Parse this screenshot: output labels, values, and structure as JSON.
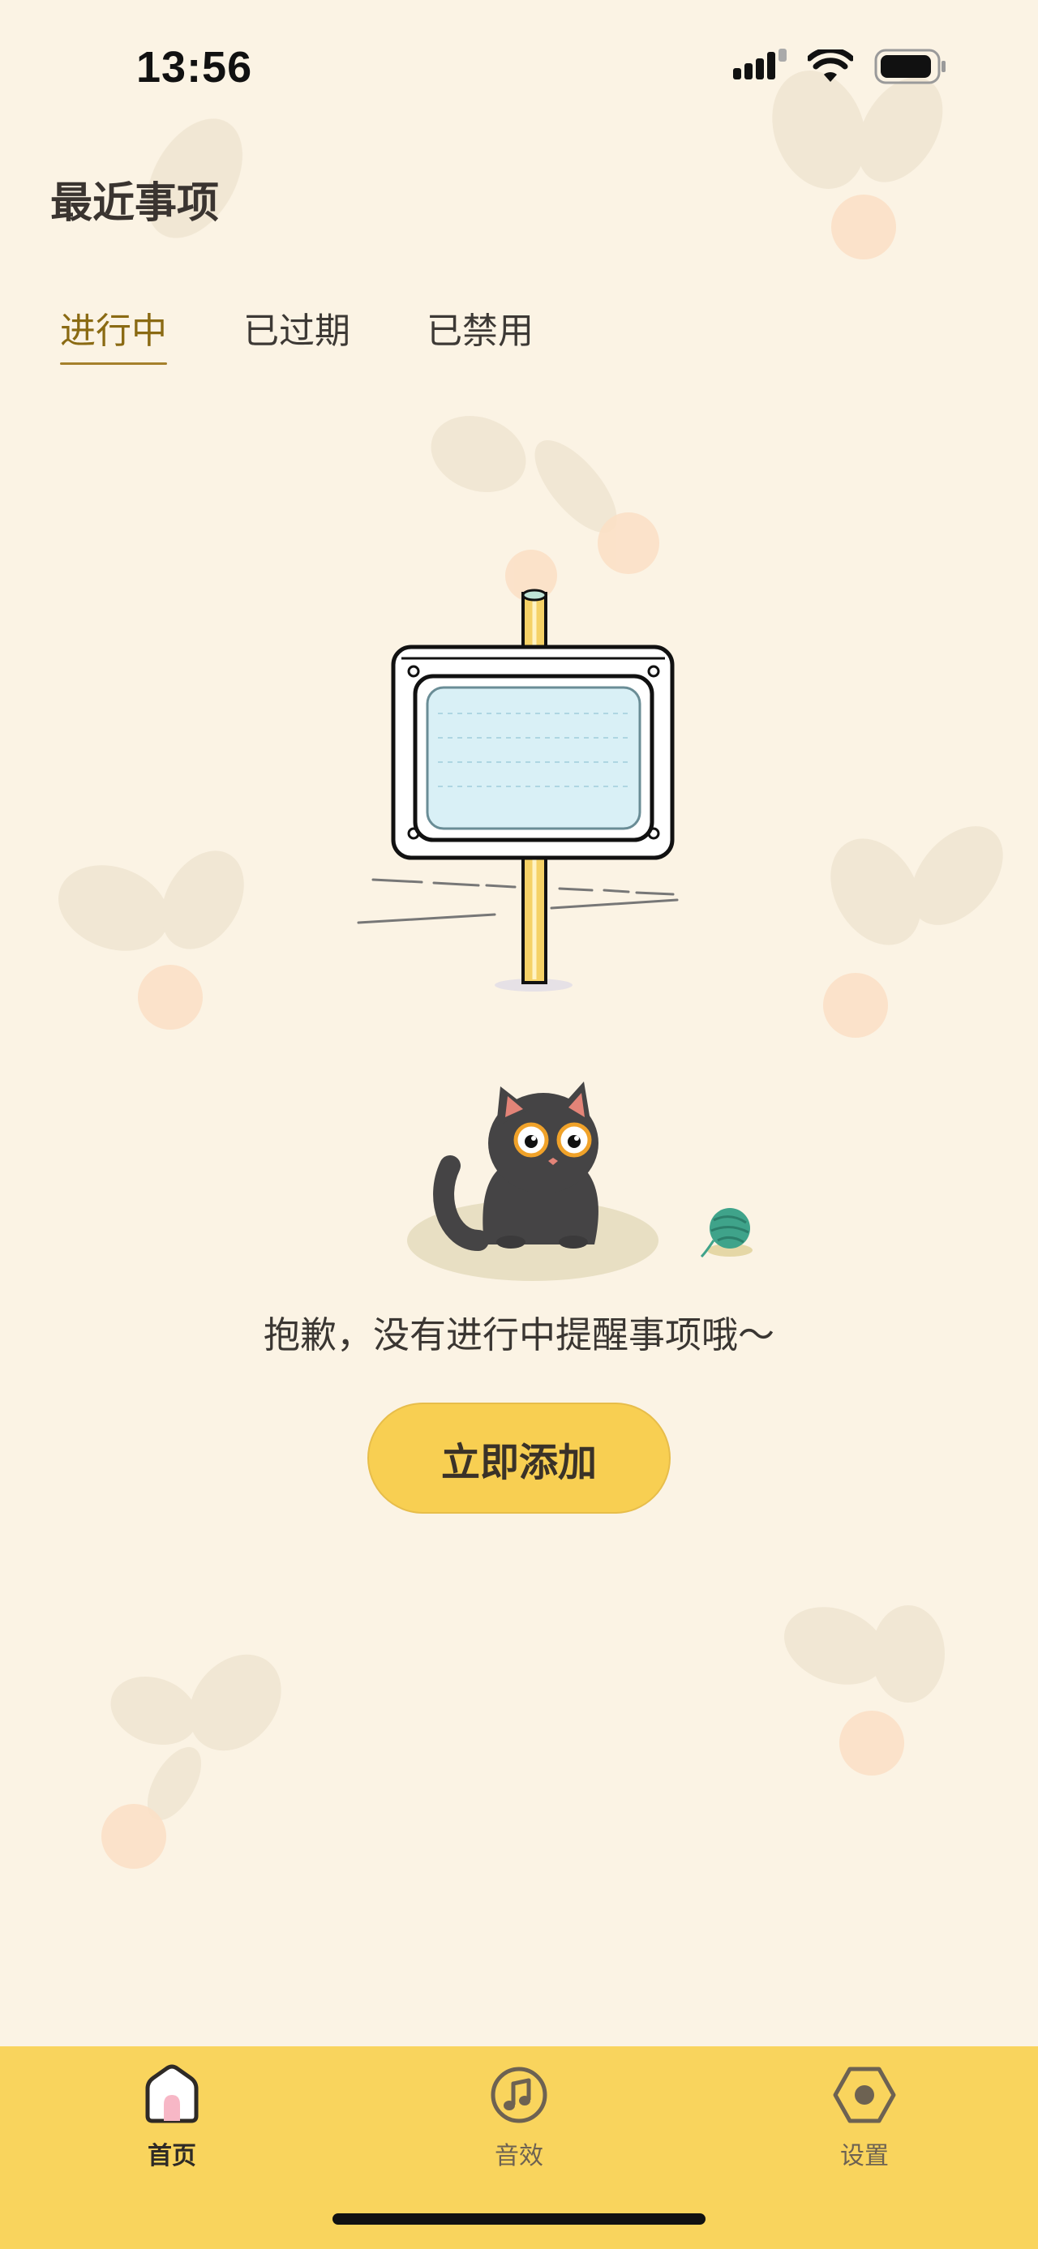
{
  "status_bar": {
    "time": "13:56"
  },
  "header": {
    "title": "最近事项"
  },
  "tabs": [
    {
      "label": "进行中",
      "active": true
    },
    {
      "label": "已过期",
      "active": false
    },
    {
      "label": "已禁用",
      "active": false
    }
  ],
  "empty_state": {
    "message": "抱歉，没有进行中提醒事项哦～",
    "button_label": "立即添加"
  },
  "bottom_nav": [
    {
      "label": "首页",
      "icon": "home-icon",
      "active": true
    },
    {
      "label": "音效",
      "icon": "music-note-icon",
      "active": false
    },
    {
      "label": "设置",
      "icon": "hexagon-settings-icon",
      "active": false
    }
  ],
  "colors": {
    "background": "#fbf3e4",
    "accent": "#f8cf52",
    "active_tab": "#8a6a13",
    "nav_bar": "#f9d45d"
  }
}
